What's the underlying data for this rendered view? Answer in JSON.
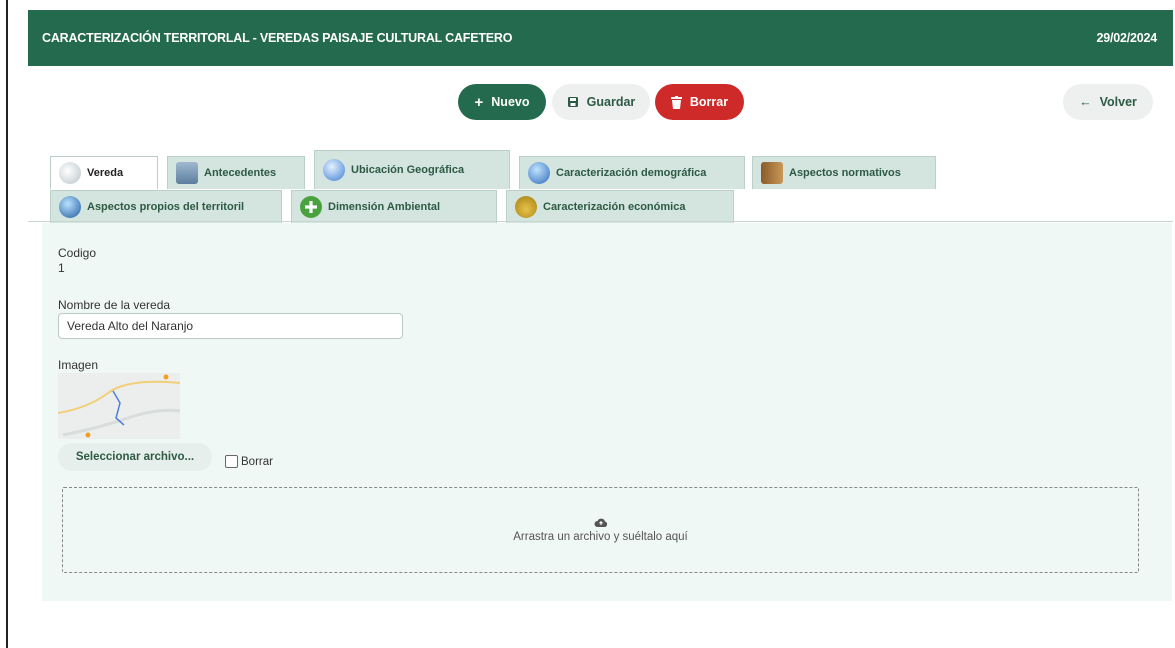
{
  "header": {
    "title": "CARACTERIZACIÓN TERRITORLAL - VEREDAS PAISAJE CULTURAL CAFETERO",
    "date": "29/02/2024"
  },
  "toolbar": {
    "new_label": "Nuevo",
    "save_label": "Guardar",
    "delete_label": "Borrar",
    "back_label": "Volver"
  },
  "tabs": [
    {
      "label": "Vereda",
      "icon": "cloud-icon"
    },
    {
      "label": "Antecedentes",
      "icon": "card-add-icon"
    },
    {
      "label": "Ubicación Geográfica",
      "icon": "globe-icon"
    },
    {
      "label": "Caracterización demográfica",
      "icon": "globe-icon"
    },
    {
      "label": "Aspectos normativos",
      "icon": "law-book-icon"
    },
    {
      "label": "Aspectos propios del territoril",
      "icon": "globe-car-icon"
    },
    {
      "label": "Dimensión Ambiental",
      "icon": "plus-circle-icon"
    },
    {
      "label": "Caracterización económica",
      "icon": "money-bag-icon"
    }
  ],
  "form": {
    "codigo_label": "Codigo",
    "codigo_value": "1",
    "nombre_label": "Nombre de la vereda",
    "nombre_value": "Vereda Alto del Naranjo",
    "imagen_label": "Imagen",
    "file_button": "Seleccionar archivo...",
    "borrar_checkbox_label": "Borrar",
    "dropzone_text": "Arrastra un archivo y suéltalo aquí"
  },
  "colors": {
    "brand": "#236a4e",
    "danger": "#cf2a2a",
    "tab_bg": "#d4e4df",
    "panel_bg": "#f0f8f6"
  }
}
